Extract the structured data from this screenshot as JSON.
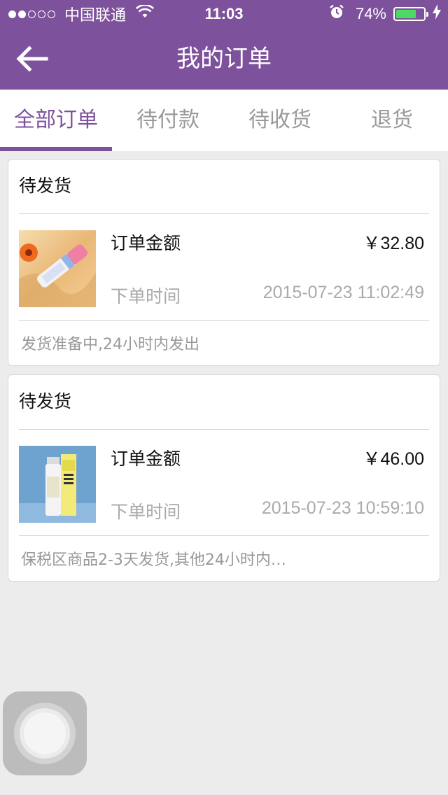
{
  "status_bar": {
    "signal_dots_filled": 2,
    "signal_dots_total": 5,
    "carrier": "中国联通",
    "time": "11:03",
    "battery_percent_label": "74%",
    "battery_level": 0.74,
    "icons": [
      "wifi-icon",
      "alarm-icon",
      "battery-icon",
      "charging-bolt-icon"
    ]
  },
  "nav": {
    "title": "我的订单",
    "back_icon": "arrow-left-icon"
  },
  "tabs": [
    {
      "label": "全部订单",
      "active": true
    },
    {
      "label": "待付款",
      "active": false
    },
    {
      "label": "待收货",
      "active": false
    },
    {
      "label": "退货",
      "active": false
    }
  ],
  "orders": [
    {
      "status": "待发货",
      "amount_label": "订单金额",
      "amount": "￥32.80",
      "time_label": "下单时间",
      "time": "2015-07-23 11:02:49",
      "note": "发货准备中,24小时内发出",
      "product_image": "pink-spray-bottle-with-flower"
    },
    {
      "status": "待发货",
      "amount_label": "订单金额",
      "amount": "￥46.00",
      "time_label": "下单时间",
      "time": "2015-07-23 10:59:10",
      "note": "保税区商品2-3天发货,其他24小时内…",
      "product_image": "white-bottle-with-yellow-egg-pack-box"
    }
  ],
  "colors": {
    "brand": "#7d519b",
    "background": "#ececec",
    "muted_text": "#aaaaaa",
    "battery_green": "#4cd964"
  }
}
